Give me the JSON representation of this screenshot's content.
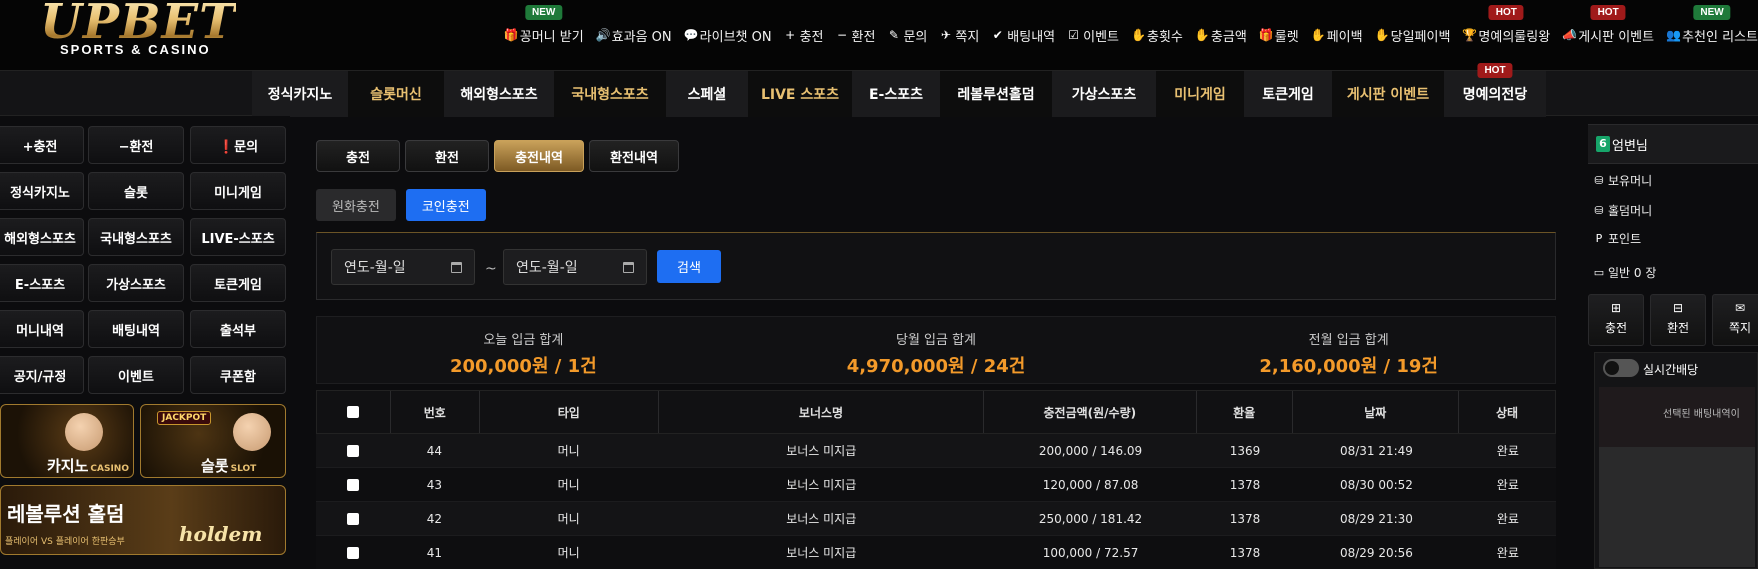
{
  "brand": {
    "logo_main": "UPBET",
    "logo_sub": "SPORTS & CASINO"
  },
  "topnav": [
    {
      "icon": "gift-icon",
      "glyph": "🎁",
      "label": "꽁머니 받기",
      "tag": "NEW",
      "tag_type": "new"
    },
    {
      "icon": "speaker-icon",
      "glyph": "🔊",
      "label": "효과음 ON"
    },
    {
      "icon": "chat-icon",
      "glyph": "💬",
      "label": "라이브챗 ON"
    },
    {
      "icon": "plus-icon",
      "glyph": "+",
      "label": "충전"
    },
    {
      "icon": "minus-icon",
      "glyph": "−",
      "label": "환전"
    },
    {
      "icon": "edit-icon",
      "glyph": "✎",
      "label": "문의"
    },
    {
      "icon": "paper-plane-icon",
      "glyph": "✈",
      "label": "쪽지"
    },
    {
      "icon": "check-icon",
      "glyph": "✔",
      "label": "배팅내역"
    },
    {
      "icon": "calendar-check-icon",
      "glyph": "☑",
      "label": "이벤트"
    },
    {
      "icon": "hand-coin-icon",
      "glyph": "✋",
      "label": "충횟수"
    },
    {
      "icon": "hand-coin-icon",
      "glyph": "✋",
      "label": "충금액"
    },
    {
      "icon": "gift-icon",
      "glyph": "🎁",
      "label": "룰렛"
    },
    {
      "icon": "hand-coin-icon",
      "glyph": "✋",
      "label": "페이백"
    },
    {
      "icon": "hand-coin-icon",
      "glyph": "✋",
      "label": "당일페이백"
    },
    {
      "icon": "trophy-icon",
      "glyph": "🏆",
      "label": "명예의룰링왕",
      "tag": "HOT",
      "tag_type": "hot"
    },
    {
      "icon": "bullhorn-icon",
      "glyph": "📣",
      "label": "게시판 이벤트",
      "tag": "HOT",
      "tag_type": "hot"
    },
    {
      "icon": "users-icon",
      "glyph": "👥",
      "label": "추천인 리스트",
      "tag": "NEW",
      "tag_type": "new"
    }
  ],
  "mainnav": [
    {
      "label": "정식카지노",
      "style": "dark",
      "w": 96
    },
    {
      "label": "슬롯머신",
      "style": "gold",
      "w": 96
    },
    {
      "label": "해외형스포츠",
      "style": "dark",
      "w": 110
    },
    {
      "label": "국내형스포츠",
      "style": "gold",
      "w": 112
    },
    {
      "label": "스페셜",
      "style": "dark",
      "w": 82
    },
    {
      "label": "LIVE 스포츠",
      "style": "gold",
      "w": 104
    },
    {
      "label": "E-스포츠",
      "style": "dark",
      "w": 88
    },
    {
      "label": "레볼루션홀덤",
      "style": "light",
      "w": 112
    },
    {
      "label": "가상스포츠",
      "style": "dark",
      "w": 104
    },
    {
      "label": "미니게임",
      "style": "gold",
      "w": 88
    },
    {
      "label": "토큰게임",
      "style": "dark",
      "w": 88
    },
    {
      "label": "게시판 이벤트",
      "style": "gold",
      "w": 112
    },
    {
      "label": "명예의전당",
      "style": "dark",
      "w": 102,
      "tag": "HOT"
    }
  ],
  "sidebar": {
    "buttons": [
      {
        "label": "+충전",
        "name": "deposit"
      },
      {
        "label": "−환전",
        "name": "withdraw"
      },
      {
        "label": "❗문의",
        "name": "inquiry"
      },
      {
        "label": "정식카지노",
        "name": "casino"
      },
      {
        "label": "슬롯",
        "name": "slot"
      },
      {
        "label": "미니게임",
        "name": "minigame"
      },
      {
        "label": "해외형스포츠",
        "name": "intl-sports"
      },
      {
        "label": "국내형스포츠",
        "name": "domestic-sports"
      },
      {
        "label": "LIVE-스포츠",
        "name": "live-sports"
      },
      {
        "label": "E-스포츠",
        "name": "esports"
      },
      {
        "label": "가상스포츠",
        "name": "virtual-sports"
      },
      {
        "label": "토큰게임",
        "name": "token-game"
      },
      {
        "label": "머니내역",
        "name": "money-history"
      },
      {
        "label": "배팅내역",
        "name": "bet-history"
      },
      {
        "label": "출석부",
        "name": "attendance"
      },
      {
        "label": "공지/규정",
        "name": "notice"
      },
      {
        "label": "이벤트",
        "name": "event"
      },
      {
        "label": "쿠폰함",
        "name": "coupon"
      }
    ],
    "banner_casino": {
      "label": "카지노",
      "sub": "CASINO"
    },
    "banner_slot": {
      "label": "슬롯",
      "sub": "SLOT",
      "jackpot": "JACKPOT"
    },
    "banner_holdem": {
      "title": "레볼루션 홀덤",
      "sub": "플레이어 VS 플레이어 한판승부",
      "word": "holdem"
    }
  },
  "content": {
    "tabs": [
      {
        "label": "충전",
        "active": false
      },
      {
        "label": "환전",
        "active": false
      },
      {
        "label": "충전내역",
        "active": true
      },
      {
        "label": "환전내역",
        "active": false
      }
    ],
    "subtabs": [
      {
        "label": "원화충전",
        "active": false
      },
      {
        "label": "코인충전",
        "active": true
      }
    ],
    "search": {
      "from_placeholder": "연도-월-일",
      "separator": "~",
      "to_placeholder": "연도-월-일",
      "button": "검색"
    },
    "summary": [
      {
        "label": "오늘 입금 합계",
        "value": "200,000원 / 1건"
      },
      {
        "label": "당월 입금 합계",
        "value": "4,970,000원 / 24건"
      },
      {
        "label": "전월 입금 합계",
        "value": "2,160,000원 / 19건"
      }
    ],
    "table": {
      "columns": [
        "",
        "번호",
        "타입",
        "보너스명",
        "충전금액(원/수량)",
        "환율",
        "날짜",
        "상태"
      ],
      "rows": [
        [
          "44",
          "머니",
          "보너스 미지급",
          "200,000 / 146.09",
          "1369",
          "08/31 21:49",
          "완료"
        ],
        [
          "43",
          "머니",
          "보너스 미지급",
          "120,000 / 87.08",
          "1378",
          "08/30 00:52",
          "완료"
        ],
        [
          "42",
          "머니",
          "보너스 미지급",
          "250,000 / 181.42",
          "1378",
          "08/29 21:30",
          "완료"
        ],
        [
          "41",
          "머니",
          "보너스 미지급",
          "100,000 / 72.57",
          "1378",
          "08/29 20:56",
          "완료"
        ]
      ]
    }
  },
  "right": {
    "level": "6",
    "username": "엄변님",
    "lines": [
      {
        "icon": "coins-icon",
        "glyph": "⛁",
        "label": "보유머니"
      },
      {
        "icon": "coins-icon",
        "glyph": "⛁",
        "label": "홀덤머니"
      },
      {
        "icon": "point-icon",
        "glyph": "P",
        "label": "포인트"
      },
      {
        "icon": "ticket-icon",
        "glyph": "▭",
        "label": "일반 0 장"
      }
    ],
    "buttons": [
      {
        "icon": "plus-square-icon",
        "glyph": "⊞",
        "label": "충전"
      },
      {
        "icon": "minus-square-icon",
        "glyph": "⊟",
        "label": "환전"
      },
      {
        "icon": "envelope-icon",
        "glyph": "✉",
        "label": "쪽지"
      }
    ],
    "live_label": "실시간배당",
    "live_empty": "선택된 배팅내역이"
  }
}
